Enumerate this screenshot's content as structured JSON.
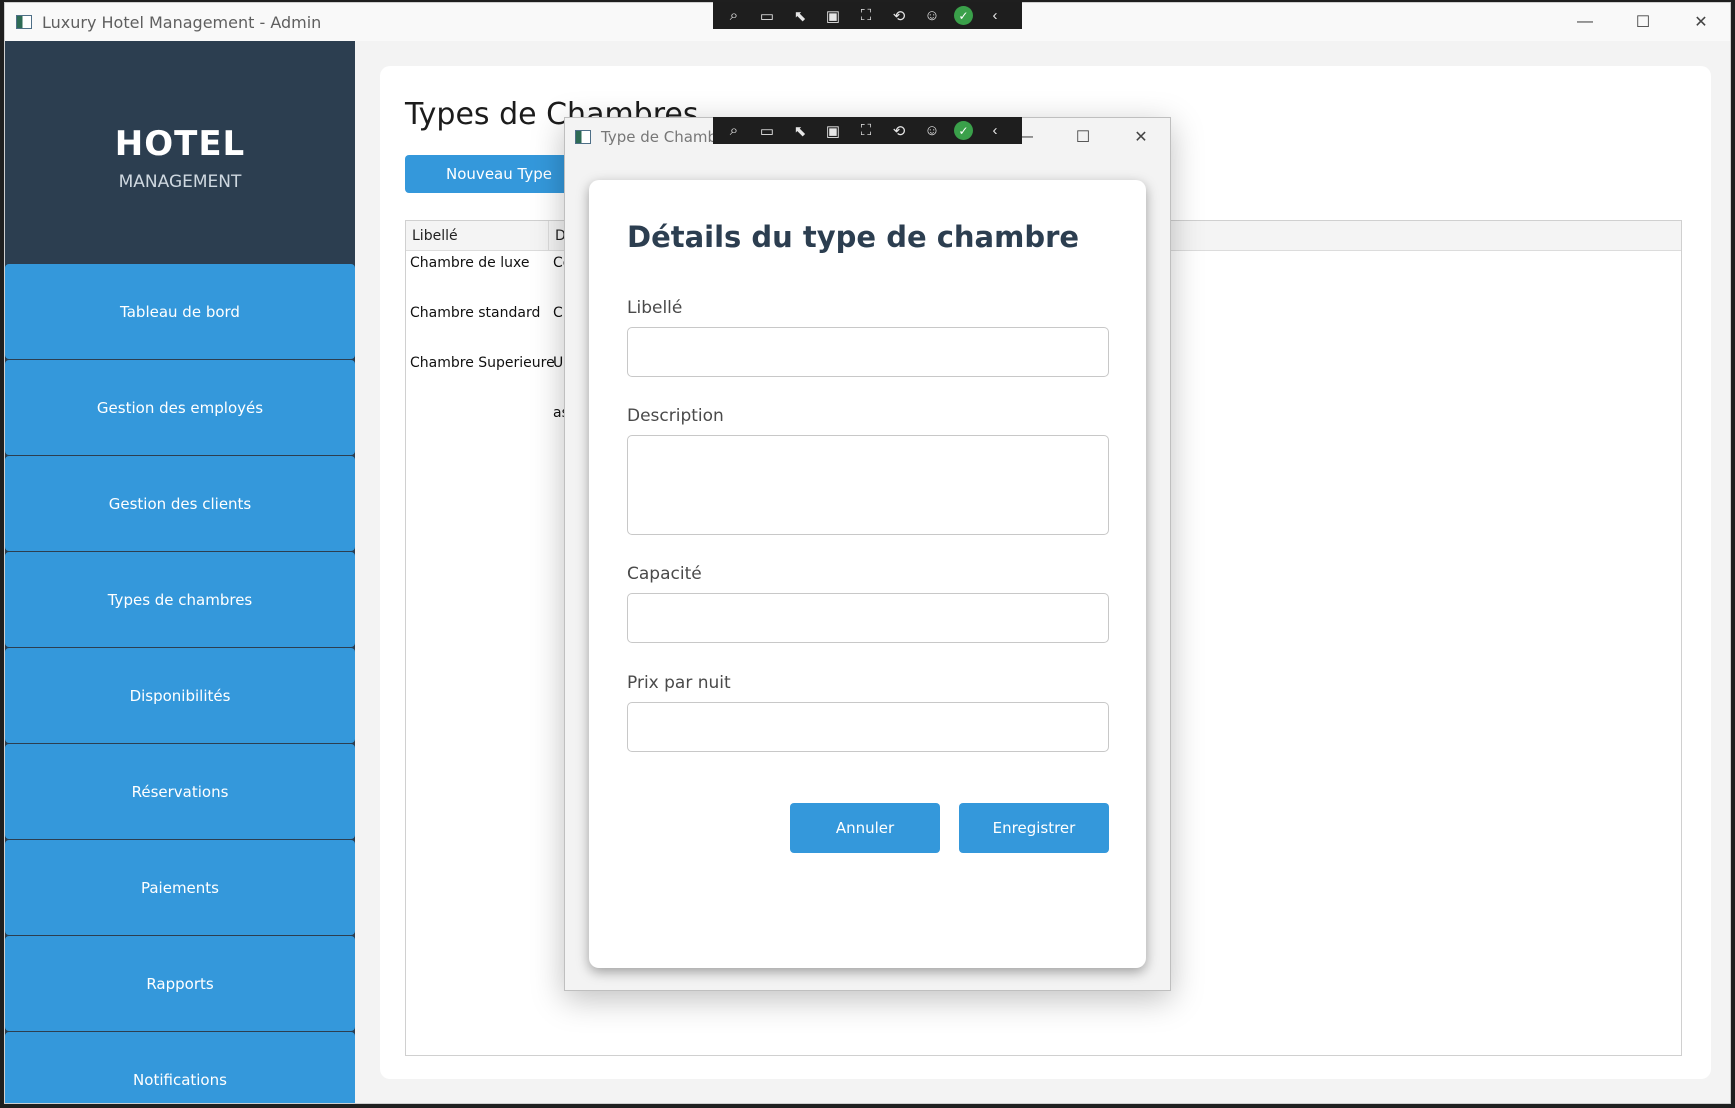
{
  "window": {
    "title": "Luxury Hotel Management - Admin",
    "controls": {
      "minimize": "—",
      "maximize": "☐",
      "close": "✕"
    }
  },
  "sidebar": {
    "brand_title": "HOTEL",
    "brand_subtitle": "MANAGEMENT",
    "items": [
      {
        "label": "Tableau de bord"
      },
      {
        "label": "Gestion des employés"
      },
      {
        "label": "Gestion des clients"
      },
      {
        "label": "Types de chambres"
      },
      {
        "label": "Disponibilités"
      },
      {
        "label": "Réservations"
      },
      {
        "label": "Paiements"
      },
      {
        "label": "Rapports"
      },
      {
        "label": "Notifications"
      }
    ]
  },
  "main": {
    "title": "Types de Chambres",
    "new_button": "Nouveau Type",
    "table": {
      "columns": [
        "Libellé",
        "D"
      ],
      "rows": [
        {
          "libelle": "Chambre de luxe",
          "description": "Co"
        },
        {
          "libelle": "Chambre standard",
          "description": "C'"
        },
        {
          "libelle": "Chambre Superieure",
          "description": "Ur"
        },
        {
          "libelle": "",
          "description": "as"
        }
      ]
    }
  },
  "dialog": {
    "window_title": "Type de Chambre",
    "heading": "Détails du type de chambre",
    "fields": {
      "libelle_label": "Libellé",
      "libelle_value": "",
      "description_label": "Description",
      "description_value": "",
      "capacite_label": "Capacité",
      "capacite_value": "",
      "prix_label": "Prix par nuit",
      "prix_value": ""
    },
    "cancel_button": "Annuler",
    "save_button": "Enregistrer"
  },
  "debug_toolbar": {
    "icons": [
      "select-element-icon",
      "video-icon",
      "pointer-icon",
      "layout-adorner-icon",
      "track-focus-icon",
      "hot-reload-icon",
      "accessibility-icon",
      "binding-ok-icon",
      "collapse-icon"
    ]
  },
  "colors": {
    "sidebar_bg": "#2c3e50",
    "accent": "#3498db",
    "heading": "#2c3e50"
  }
}
